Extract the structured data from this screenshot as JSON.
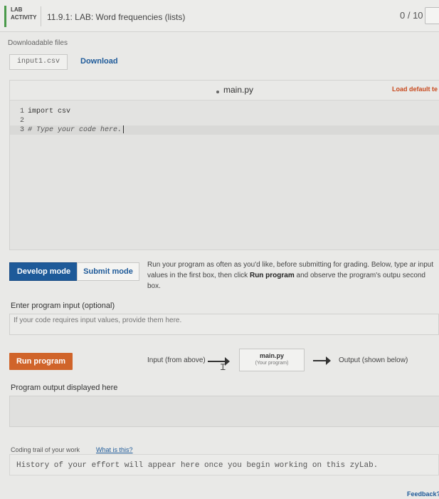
{
  "header": {
    "badge_line1": "LAB",
    "badge_line2": "ACTIVITY",
    "title": "11.9.1: LAB: Word frequencies (lists)",
    "score": "0 / 10"
  },
  "downloads": {
    "heading": "Downloadable files",
    "file_name": "input1.csv",
    "download_label": "Download"
  },
  "editor": {
    "file_tab": "main.py",
    "load_default": "Load default te",
    "lines": [
      {
        "num": "1",
        "text": "import csv"
      },
      {
        "num": "2",
        "text": ""
      },
      {
        "num": "3",
        "text": "# Type your code here."
      }
    ]
  },
  "modes": {
    "develop": "Develop mode",
    "submit": "Submit mode",
    "desc_part1": "Run your program as often as you'd like, before submitting for grading. Below, type ar input values in the first box, then click ",
    "desc_bold": "Run program",
    "desc_part2": " and observe the program's outpu second box."
  },
  "input": {
    "label": "Enter program input (optional)",
    "placeholder": "If your code requires input values, provide them here."
  },
  "run": {
    "button": "Run program",
    "input_from": "Input (from above)",
    "main_name": "main.py",
    "main_sub": "(Your program)",
    "output_to": "Output (shown below)"
  },
  "output": {
    "label": "Program output displayed here"
  },
  "trail": {
    "label": "Coding trail of your work",
    "link": "What is this?",
    "text": "History of your effort will appear here once you begin working on this zyLab."
  },
  "footer": {
    "feedback": "Feedback?"
  }
}
